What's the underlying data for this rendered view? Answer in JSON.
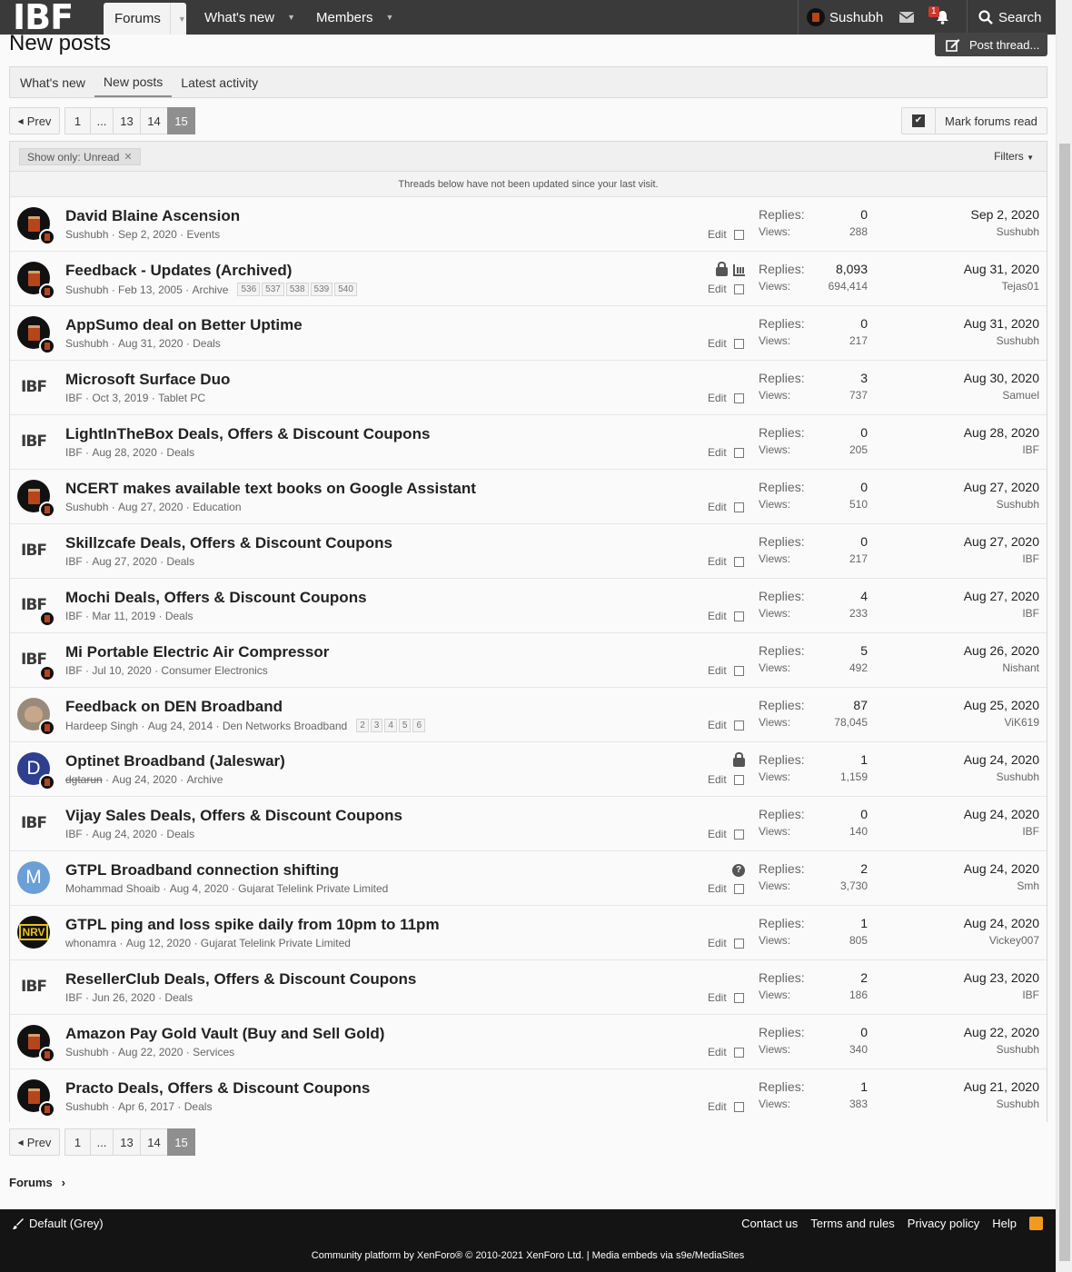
{
  "nav": {
    "logo": "IBF",
    "tabs": [
      "Forums",
      "What's new",
      "Members"
    ],
    "user": "Sushubh",
    "alert_count": "1",
    "search_label": "Search"
  },
  "page": {
    "title": "New posts",
    "post_thread_label": "Post thread...",
    "subtabs": [
      "What's new",
      "New posts",
      "Latest activity"
    ],
    "pager": [
      "Prev",
      "1",
      "...",
      "13",
      "14",
      "15"
    ],
    "mark_read_label": "Mark forums read",
    "filter_chip": "Show only: Unread",
    "filters_label": "Filters",
    "notice": "Threads below have not been updated since your last visit.",
    "labels": {
      "replies": "Replies:",
      "views": "Views:",
      "edit": "Edit"
    }
  },
  "threads": [
    {
      "title": "David Blaine Ascension",
      "author": "Sushubh",
      "date": "Sep 2, 2020",
      "forum": "Events",
      "replies": "0",
      "views": "288",
      "last_date": "Sep 2, 2020",
      "last_user": "Sushubh",
      "avatar": "cup"
    },
    {
      "title": "Feedback - Updates (Archived)",
      "author": "Sushubh",
      "date": "Feb 13, 2005",
      "forum": "Archive",
      "pages": [
        "536",
        "537",
        "538",
        "539",
        "540"
      ],
      "icons": [
        "lock",
        "poll"
      ],
      "replies": "8,093",
      "views": "694,414",
      "last_date": "Aug 31, 2020",
      "last_user": "Tejas01",
      "avatar": "cup"
    },
    {
      "title": "AppSumo deal on Better Uptime",
      "author": "Sushubh",
      "date": "Aug 31, 2020",
      "forum": "Deals",
      "replies": "0",
      "views": "217",
      "last_date": "Aug 31, 2020",
      "last_user": "Sushubh",
      "avatar": "cup"
    },
    {
      "title": "Microsoft Surface Duo",
      "author": "IBF",
      "date": "Oct 3, 2019",
      "forum": "Tablet PC",
      "replies": "3",
      "views": "737",
      "last_date": "Aug 30, 2020",
      "last_user": "Samuel",
      "avatar": "ibf"
    },
    {
      "title": "LightInTheBox Deals, Offers & Discount Coupons",
      "author": "IBF",
      "date": "Aug 28, 2020",
      "forum": "Deals",
      "replies": "0",
      "views": "205",
      "last_date": "Aug 28, 2020",
      "last_user": "IBF",
      "avatar": "ibf"
    },
    {
      "title": "NCERT makes available text books on Google Assistant",
      "author": "Sushubh",
      "date": "Aug 27, 2020",
      "forum": "Education",
      "replies": "0",
      "views": "510",
      "last_date": "Aug 27, 2020",
      "last_user": "Sushubh",
      "avatar": "cup"
    },
    {
      "title": "Skillzcafe Deals, Offers & Discount Coupons",
      "author": "IBF",
      "date": "Aug 27, 2020",
      "forum": "Deals",
      "replies": "0",
      "views": "217",
      "last_date": "Aug 27, 2020",
      "last_user": "IBF",
      "avatar": "ibf"
    },
    {
      "title": "Mochi Deals, Offers & Discount Coupons",
      "author": "IBF",
      "date": "Mar 11, 2019",
      "forum": "Deals",
      "replies": "4",
      "views": "233",
      "last_date": "Aug 27, 2020",
      "last_user": "IBF",
      "avatar": "ibf-badge"
    },
    {
      "title": "Mi Portable Electric Air Compressor",
      "author": "IBF",
      "date": "Jul 10, 2020",
      "forum": "Consumer Electronics",
      "replies": "5",
      "views": "492",
      "last_date": "Aug 26, 2020",
      "last_user": "Nishant",
      "avatar": "ibf-badge"
    },
    {
      "title": "Feedback on DEN Broadband",
      "author": "Hardeep Singh",
      "date": "Aug 24, 2014",
      "forum": "Den Networks Broadband",
      "pages": [
        "2",
        "3",
        "4",
        "5",
        "6"
      ],
      "replies": "87",
      "views": "78,045",
      "last_date": "Aug 25, 2020",
      "last_user": "ViK619",
      "avatar": "photo"
    },
    {
      "title": "Optinet Broadband (Jaleswar)",
      "author": "dgtarun",
      "author_strike": true,
      "date": "Aug 24, 2020",
      "forum": "Archive",
      "icons": [
        "lock"
      ],
      "replies": "1",
      "views": "1,159",
      "last_date": "Aug 24, 2020",
      "last_user": "Sushubh",
      "avatar": "letter",
      "avatar_letter": "D",
      "avatar_color": "#2f3f8f"
    },
    {
      "title": "Vijay Sales Deals, Offers & Discount Coupons",
      "author": "IBF",
      "date": "Aug 24, 2020",
      "forum": "Deals",
      "replies": "0",
      "views": "140",
      "last_date": "Aug 24, 2020",
      "last_user": "IBF",
      "avatar": "ibf"
    },
    {
      "title": "GTPL Broadband connection shifting",
      "author": "Mohammad Shoaib",
      "date": "Aug 4, 2020",
      "forum": "Gujarat Telelink Private Limited",
      "icons": [
        "question"
      ],
      "replies": "2",
      "views": "3,730",
      "last_date": "Aug 24, 2020",
      "last_user": "Smh",
      "avatar": "letter",
      "avatar_letter": "M",
      "avatar_color": "#6a9fd8"
    },
    {
      "title": "GTPL ping and loss spike daily from 10pm to 11pm",
      "author": "whonamra",
      "date": "Aug 12, 2020",
      "forum": "Gujarat Telelink Private Limited",
      "replies": "1",
      "views": "805",
      "last_date": "Aug 24, 2020",
      "last_user": "Vickey007",
      "avatar": "nrv",
      "avatar_text": "NRV"
    },
    {
      "title": "ResellerClub Deals, Offers & Discount Coupons",
      "author": "IBF",
      "date": "Jun 26, 2020",
      "forum": "Deals",
      "replies": "2",
      "views": "186",
      "last_date": "Aug 23, 2020",
      "last_user": "IBF",
      "avatar": "ibf"
    },
    {
      "title": "Amazon Pay Gold Vault (Buy and Sell Gold)",
      "author": "Sushubh",
      "date": "Aug 22, 2020",
      "forum": "Services",
      "replies": "0",
      "views": "340",
      "last_date": "Aug 22, 2020",
      "last_user": "Sushubh",
      "avatar": "cup"
    },
    {
      "title": "Practo Deals, Offers & Discount Coupons",
      "author": "Sushubh",
      "date": "Apr 6, 2017",
      "forum": "Deals",
      "replies": "1",
      "views": "383",
      "last_date": "Aug 21, 2020",
      "last_user": "Sushubh",
      "avatar": "cup"
    }
  ],
  "breadcrumb": "Forums",
  "footer": {
    "style_label": "Default (Grey)",
    "links": [
      "Contact us",
      "Terms and rules",
      "Privacy policy",
      "Help"
    ],
    "copyright": "Community platform by XenForo® © 2010-2021 XenForo Ltd. | Media embeds via s9e/MediaSites"
  },
  "colors": {
    "topbar": "#3a3a3a",
    "footer": "#141414",
    "active_page": "#8f8f8f",
    "alert": "#c8382c",
    "rss": "#f39a1e"
  },
  "icons": [
    "search-icon",
    "envelope-icon",
    "bell-icon",
    "edit-icon",
    "check-icon",
    "caret-down-icon",
    "lock-icon",
    "poll-icon",
    "question-icon",
    "brush-icon",
    "rss-icon"
  ]
}
